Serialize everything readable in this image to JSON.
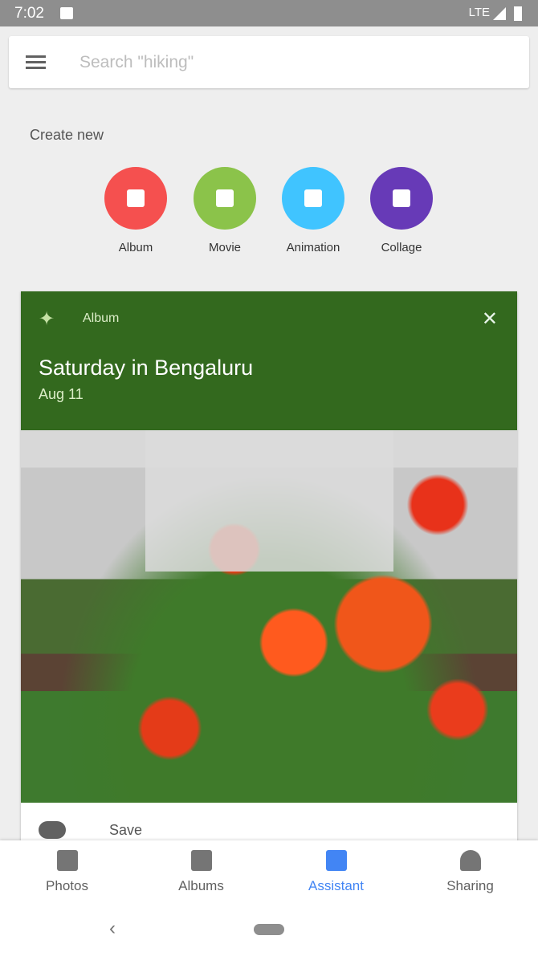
{
  "status": {
    "time": "7:02",
    "network": "LTE"
  },
  "search": {
    "placeholder": "Search \"hiking\""
  },
  "create_new": {
    "title": "Create new",
    "items": [
      {
        "label": "Album",
        "color": "#f5504f",
        "icon": "photo-album-icon"
      },
      {
        "label": "Movie",
        "color": "#8bc34a",
        "icon": "movie-clapper-icon"
      },
      {
        "label": "Animation",
        "color": "#40c4ff",
        "icon": "animation-icon"
      },
      {
        "label": "Collage",
        "color": "#673ab7",
        "icon": "collage-icon"
      }
    ]
  },
  "card": {
    "type": "Album",
    "title": "Saturday in Bengaluru",
    "date": "Aug 11",
    "header_color": "#33691e",
    "action": "Save"
  },
  "nav": {
    "tabs": [
      {
        "label": "Photos"
      },
      {
        "label": "Albums"
      },
      {
        "label": "Assistant",
        "active": true
      },
      {
        "label": "Sharing"
      }
    ],
    "accent": "#4285f4"
  }
}
